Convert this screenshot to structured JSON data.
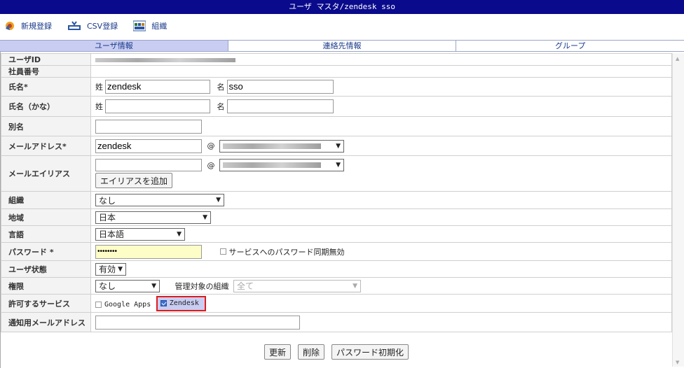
{
  "window": {
    "title": "ユーザ マスタ/zendesk sso"
  },
  "toolbar": {
    "new_label": "新規登録",
    "csv_label": "CSV登録",
    "org_label": "組織"
  },
  "tabs": [
    "ユーザ情報",
    "連絡先情報",
    "グループ"
  ],
  "form": {
    "user_id_label": "ユーザID",
    "employee_no_label": "社員番号",
    "name_label": "氏名*",
    "name_last_prefix": "姓",
    "name_last": "zendesk",
    "name_first_prefix": "名",
    "name_first": "sso",
    "kana_label": "氏名（かな）",
    "kana_last_prefix": "姓",
    "kana_first_prefix": "名",
    "alias_label": "別名",
    "email_label": "メールアドレス*",
    "email_local": "zendesk",
    "at": "@",
    "email_alias_label": "メールエイリアス",
    "add_alias_button": "エイリアスを追加",
    "org_label": "組織",
    "org_value": "なし",
    "region_label": "地域",
    "region_value": "日本",
    "lang_label": "言語",
    "lang_value": "日本語",
    "password_label": "パスワード *",
    "password_value": "••••••••",
    "pw_sync_label": "サービスへのパスワード同期無効",
    "status_label": "ユーザ状態",
    "status_value": "有効",
    "perm_label": "権限",
    "perm_value": "なし",
    "managed_org_label": "管理対象の組織",
    "managed_org_value": "全て",
    "services_label": "許可するサービス",
    "service_google": "Google Apps",
    "service_zendesk": "Zendesk",
    "notify_email_label": "通知用メールアドレス"
  },
  "actions": {
    "update": "更新",
    "delete": "削除",
    "reset_pw": "パスワード初期化"
  },
  "colors": {
    "titlebar": "#0a0a8c",
    "active_tab": "#c9cdf2",
    "highlight": "#e01b1b"
  }
}
